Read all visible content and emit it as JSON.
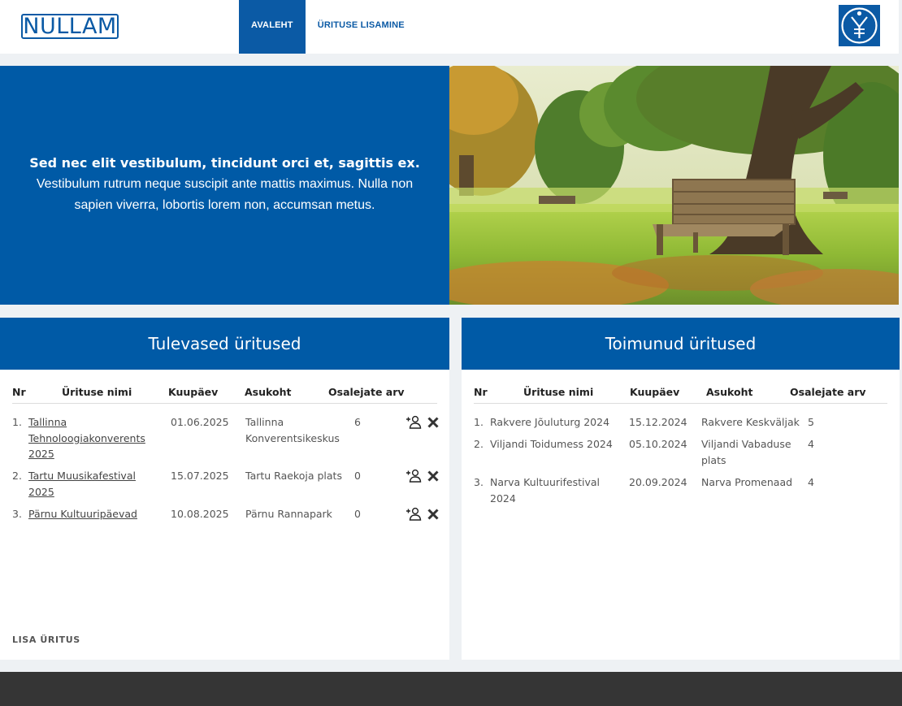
{
  "header": {
    "logo_text": "NULLAM",
    "nav": [
      "AVALEHT",
      "ÜRITUSE LISAMINE"
    ],
    "emblem_icon": "tick-emblem-icon"
  },
  "hero": {
    "title": "Sed nec elit vestibulum, tincidunt orci et, sagittis ex.",
    "subtitle": "Vestibulum rutrum neque suscipit ante mattis maximus. Nulla non sapien viverra, lobortis lorem non, accumsan metus.",
    "image": "park-bench-tree"
  },
  "upcoming": {
    "title": "Tulevased üritused",
    "columns": [
      "Nr",
      "Ürituse nimi",
      "Kuupäev",
      "Asukoht",
      "Osalejate arv"
    ],
    "rows": [
      {
        "nr": "1.",
        "name": "Tallinna Tehnoloogiakonverents 2025",
        "date": "01.06.2025",
        "place": "Tallinna Konverentsikeskus",
        "count": "6"
      },
      {
        "nr": "2.",
        "name": "Tartu Muusikafestival 2025",
        "date": "15.07.2025",
        "place": "Tartu Raekoja plats",
        "count": "0"
      },
      {
        "nr": "3.",
        "name": "Pärnu Kultuuripäevad",
        "date": "10.08.2025",
        "place": "Pärnu Rannapark",
        "count": "0"
      }
    ],
    "add_label": "LISA ÜRITUS"
  },
  "past": {
    "title": "Toimunud üritused",
    "columns": [
      "Nr",
      "Ürituse nimi",
      "Kuupäev",
      "Asukoht",
      "Osalejate arv"
    ],
    "rows": [
      {
        "nr": "1.",
        "name": "Rakvere Jõuluturg 2024",
        "date": "15.12.2024",
        "place": "Rakvere Keskväljak",
        "count": "5"
      },
      {
        "nr": "2.",
        "name": "Viljandi Toidumess 2024",
        "date": "05.10.2024",
        "place": "Viljandi Vabaduse plats",
        "count": "4"
      },
      {
        "nr": "3.",
        "name": "Narva Kultuurifestival 2024",
        "date": "20.09.2024",
        "place": "Narva Promenaad",
        "count": "4"
      }
    ]
  },
  "colors": {
    "brand_blue": "#005aa6",
    "footer": "#353535",
    "page_bg": "#eef1f4"
  }
}
